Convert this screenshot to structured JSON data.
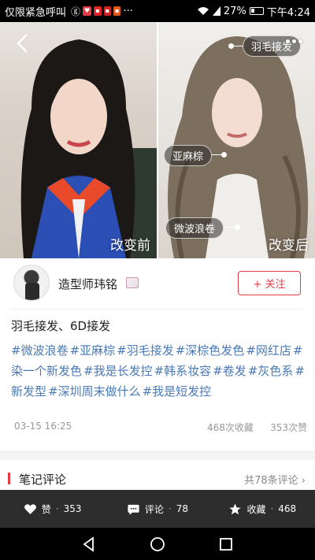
{
  "status_bar": {
    "carrier": "仅限紧急呼叫",
    "battery": "27%",
    "battery_level": 0.27,
    "time": "下午4:24"
  },
  "hero": {
    "before_label": "改变前",
    "after_label": "改变后",
    "tags": [
      "羽毛接发",
      "亚麻棕",
      "微波浪卷"
    ]
  },
  "author": {
    "name": "造型师玮铭",
    "follow_label": "+ 关注"
  },
  "post": {
    "title": "羽毛接发、6D接发",
    "hashtags": [
      "#微波浪卷",
      "#亚麻棕",
      "#羽毛接发",
      "#深棕色发色",
      "#网红店",
      "#染一个新发色",
      "#我是长发控",
      "#韩系妆容",
      "#卷发",
      "#灰色系",
      "#新发型",
      "#深圳周末做什么",
      "#我是短发控"
    ],
    "date": "03-15 16:25",
    "favorites": "468次收藏",
    "likes": "353次赞"
  },
  "comments": {
    "label": "笔记评论",
    "count": "共78条评论"
  },
  "action_bar": {
    "like_label": "赞",
    "like_count": "353",
    "comment_label": "评论",
    "comment_count": "78",
    "favorite_label": "收藏",
    "favorite_count": "468",
    "separator": "·"
  },
  "colors": {
    "accent": "#e33c45",
    "hashtag": "#4a7ab5"
  }
}
